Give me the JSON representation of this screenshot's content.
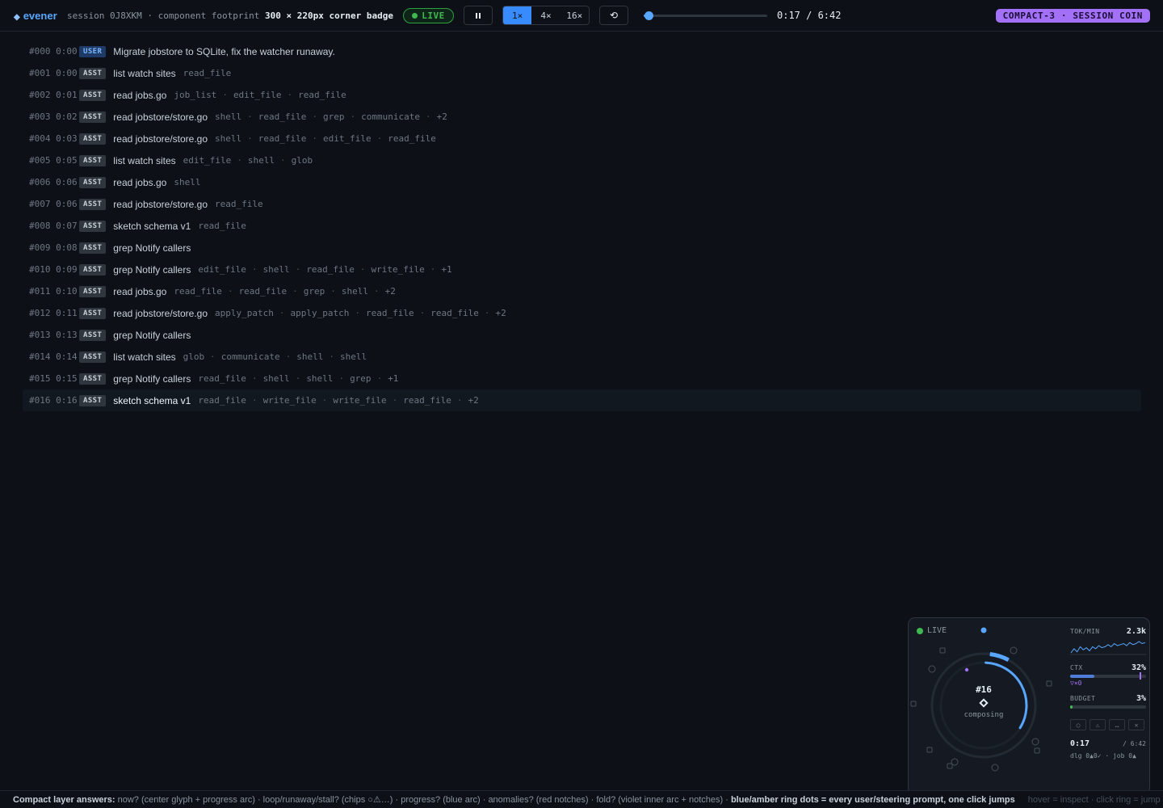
{
  "header": {
    "brand": "evener",
    "session_prefix": "session 0J8XKM · component footprint",
    "footprint": "300 × 220px corner badge",
    "live_label": "LIVE",
    "speeds": [
      "1×",
      "4×",
      "16×"
    ],
    "active_speed": "1×",
    "reset_glyph": "⟲",
    "progress_fraction": 0.042,
    "time_readout": "0:17 / 6:42",
    "coin_badge": "COMPACT-3 · SESSION COIN"
  },
  "events": [
    {
      "id": "#000",
      "time": "0:00",
      "role": "USER",
      "title": "Migrate jobstore to SQLite, fix the watcher runaway.",
      "tools": [],
      "more": ""
    },
    {
      "id": "#001",
      "time": "0:00",
      "role": "ASST",
      "title": "list watch sites",
      "tools": [
        "read_file"
      ],
      "more": ""
    },
    {
      "id": "#002",
      "time": "0:01",
      "role": "ASST",
      "title": "read jobs.go",
      "tools": [
        "job_list",
        "edit_file",
        "read_file"
      ],
      "more": ""
    },
    {
      "id": "#003",
      "time": "0:02",
      "role": "ASST",
      "title": "read jobstore/store.go",
      "tools": [
        "shell",
        "read_file",
        "grep",
        "communicate"
      ],
      "more": "+2"
    },
    {
      "id": "#004",
      "time": "0:03",
      "role": "ASST",
      "title": "read jobstore/store.go",
      "tools": [
        "shell",
        "read_file",
        "edit_file",
        "read_file"
      ],
      "more": ""
    },
    {
      "id": "#005",
      "time": "0:05",
      "role": "ASST",
      "title": "list watch sites",
      "tools": [
        "edit_file",
        "shell",
        "glob"
      ],
      "more": ""
    },
    {
      "id": "#006",
      "time": "0:06",
      "role": "ASST",
      "title": "read jobs.go",
      "tools": [
        "shell"
      ],
      "more": ""
    },
    {
      "id": "#007",
      "time": "0:06",
      "role": "ASST",
      "title": "read jobstore/store.go",
      "tools": [
        "read_file"
      ],
      "more": ""
    },
    {
      "id": "#008",
      "time": "0:07",
      "role": "ASST",
      "title": "sketch schema v1",
      "tools": [
        "read_file"
      ],
      "more": ""
    },
    {
      "id": "#009",
      "time": "0:08",
      "role": "ASST",
      "title": "grep Notify callers",
      "tools": [],
      "more": ""
    },
    {
      "id": "#010",
      "time": "0:09",
      "role": "ASST",
      "title": "grep Notify callers",
      "tools": [
        "edit_file",
        "shell",
        "read_file",
        "write_file"
      ],
      "more": "+1"
    },
    {
      "id": "#011",
      "time": "0:10",
      "role": "ASST",
      "title": "read jobs.go",
      "tools": [
        "read_file",
        "read_file",
        "grep",
        "shell"
      ],
      "more": "+2"
    },
    {
      "id": "#012",
      "time": "0:11",
      "role": "ASST",
      "title": "read jobstore/store.go",
      "tools": [
        "apply_patch",
        "apply_patch",
        "read_file",
        "read_file"
      ],
      "more": "+2"
    },
    {
      "id": "#013",
      "time": "0:13",
      "role": "ASST",
      "title": "grep Notify callers",
      "tools": [],
      "more": ""
    },
    {
      "id": "#014",
      "time": "0:14",
      "role": "ASST",
      "title": "list watch sites",
      "tools": [
        "glob",
        "communicate",
        "shell",
        "shell"
      ],
      "more": ""
    },
    {
      "id": "#015",
      "time": "0:15",
      "role": "ASST",
      "title": "grep Notify callers",
      "tools": [
        "read_file",
        "shell",
        "shell",
        "grep"
      ],
      "more": "+1"
    },
    {
      "id": "#016",
      "time": "0:16",
      "role": "ASST",
      "title": "sketch schema v1",
      "tools": [
        "read_file",
        "write_file",
        "write_file",
        "read_file"
      ],
      "more": "+2"
    }
  ],
  "current_event": "#016",
  "coin": {
    "live_label": "LIVE",
    "turn": "#16",
    "state": "composing",
    "progress_fraction": 0.33,
    "tok_label": "TOK/MIN",
    "tok_value": "2.3k",
    "tok_series": [
      3,
      7,
      4,
      9,
      6,
      8,
      5,
      9,
      7,
      10,
      8,
      9,
      11,
      9,
      12,
      10,
      11,
      12,
      10,
      13,
      11,
      12,
      14,
      12,
      13
    ],
    "ctx_label": "CTX",
    "ctx_value": "32%",
    "ctx_fraction": 0.32,
    "fold_note": "▽×0",
    "budget_label": "BUDGET",
    "budget_value": "3%",
    "budget_fraction": 0.03,
    "chips": [
      "○",
      "⚠",
      "…",
      "✕"
    ],
    "time_now": "0:17",
    "time_total": "/ 6:42",
    "counts": "dlg 0▲0✓ · job 0▲"
  },
  "colors": {
    "accent": "#58a6ff",
    "live": "#3fb950",
    "violet": "#a371f7",
    "background": "#0d1117"
  },
  "footer": {
    "lead": "Compact layer answers:",
    "body": " now? (center glyph + progress arc) · loop/runaway/stall? (chips ○⚠…) · progress? (blue arc) · anomalies? (red notches) · fold? (violet inner arc + notches) · ",
    "emphasis": "blue/amber ring dots = every user/steering prompt, one click jumps",
    "hint": "hover = inspect · click ring = jump"
  }
}
